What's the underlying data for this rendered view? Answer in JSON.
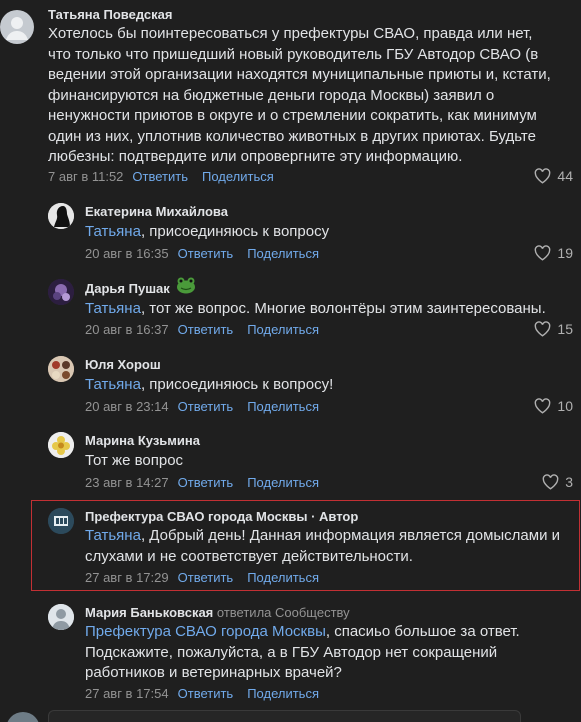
{
  "actions": {
    "reply": "Ответить",
    "share": "Поделиться"
  },
  "comments": [
    {
      "author": "Татьяна Поведская",
      "text": "Хотелось бы поинтересоваться у префектуры СВАО, правда или нет, что только что пришедший новый руководитель ГБУ Автодор СВАО (в ведении этой организации находятся муниципальные приюты и, кстати, финансируются на бюджетные деньги города Москвы) заявил о ненужности приютов в округе и о стремлении сократить, как минимум один из них, уплотнив количество животных в других приютах. Будьте любезны: подтвердите или опровергните эту информацию.",
      "time": "7 авг в 11:52",
      "likes": "44"
    },
    {
      "author": "Екатерина Михайлова",
      "mention": "Татьяна",
      "text": ", присоединяюсь к вопросу",
      "time": "20 авг в 16:35",
      "likes": "19"
    },
    {
      "author": "Дарья Пушак",
      "badge": "frog-emoji",
      "mention": "Татьяна",
      "text": ", тот же вопрос. Многие волонтёры этим заинтересованы.",
      "time": "20 авг в 16:37",
      "likes": "15"
    },
    {
      "author": "Юля Хорош",
      "mention": "Татьяна",
      "text": ", присоединяюсь к вопросу!",
      "time": "20 авг в 23:14",
      "likes": "10"
    },
    {
      "author": "Марина Кузьмина",
      "text": "Тот же вопрос",
      "time": "23 авг в 14:27",
      "likes": "3"
    },
    {
      "author": "Префектура СВАО города Москвы · Автор",
      "mention": "Татьяна",
      "text": ", Добрый день! Данная информация является домыслами и слухами и не соответствует действительности.",
      "time": "27 авг в 17:29",
      "highlighted": true
    },
    {
      "author": "Мария Баньковская",
      "replied": "ответила Сообществу",
      "mention": "Префектура СВАО города Москвы",
      "text": ", спасиьо большое за ответ. Подскажите, пожалуйста, а в ГБУ Автодор нет сокращений работников и ветеринарных врачей?",
      "time": "27 авг в 17:54"
    }
  ],
  "colors": {
    "background": "#1f1f1f",
    "link": "#71aaeb",
    "muted": "#939393",
    "highlight_border": "#c23034"
  }
}
